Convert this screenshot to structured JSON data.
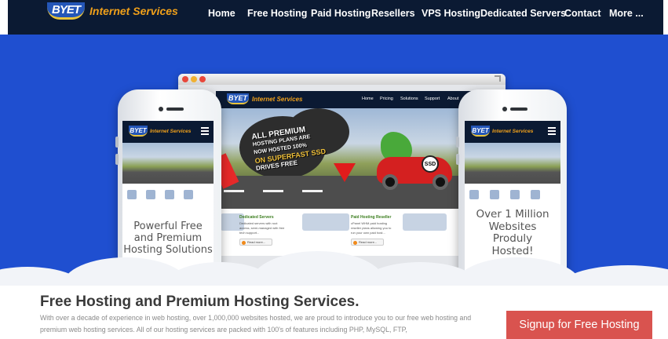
{
  "header": {
    "logo": {
      "mark": "BYET",
      "text": "Internet Services"
    },
    "nav": [
      {
        "label": "Home"
      },
      {
        "label": "Free Hosting"
      },
      {
        "label": "Paid Hosting"
      },
      {
        "label": "Resellers"
      },
      {
        "label": "VPS Hosting"
      },
      {
        "label": "Dedicated Servers"
      },
      {
        "label": "Contact"
      },
      {
        "label": "More ..."
      }
    ]
  },
  "hero": {
    "browser_mockup": {
      "logo": {
        "mark": "BYET",
        "text": "Internet Services"
      },
      "nav": [
        "Home",
        "Pricing",
        "Solutions",
        "Support",
        "About"
      ],
      "banner_lines": [
        "ALL PREMIUM",
        "HOSTING PLANS ARE",
        "NOW HOSTED 100%",
        "ON SUPERFAST SSD",
        "DRIVES FREE"
      ],
      "badge": "SSD",
      "cards": [
        {
          "title": "Dedicated Servers",
          "desc": "Dedicated servers with root access, semi-managed with free tech support...",
          "button": "Read more..."
        },
        {
          "title": "Paid Hosting Reseller",
          "desc": "cPanel WHM paid hosting reseller plans allowing you to run your own paid host...",
          "button": "Read more..."
        }
      ]
    },
    "left_phone": {
      "logo": {
        "mark": "BYET",
        "text": "Internet Services"
      },
      "caption_lines": [
        "Powerful Free",
        "and Premium",
        "Hosting Solutions"
      ]
    },
    "right_phone": {
      "logo": {
        "mark": "BYET",
        "text": "Internet Services"
      },
      "caption_lines": [
        "Over 1 Million",
        "Websites",
        "Produly",
        "Hosted!"
      ]
    }
  },
  "intro": {
    "title": "Free Hosting and Premium Hosting Services.",
    "text": "With over a decade of experience in web hosting, over 1,000,000 websites hosted, we are proud to introduce you to our free web hosting and premium web hosting services. All of our hosting services are packed with 100's of features including PHP, MySQL, FTP,",
    "signup_label": "Signup for Free Hosting"
  },
  "colors": {
    "nav_bg": "#0b1a33",
    "hero_bg": "#1f4fd0",
    "accent_orange": "#f0a01a",
    "signup_red": "#d9534f"
  }
}
